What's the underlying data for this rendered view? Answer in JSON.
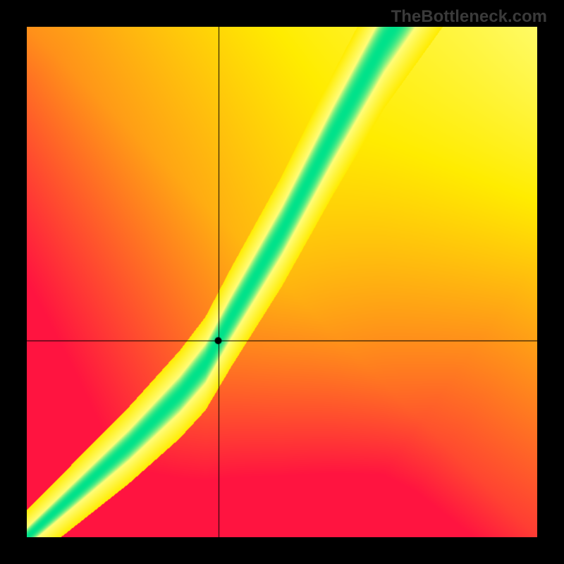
{
  "watermark": "TheBottleneck.com",
  "chart_data": {
    "type": "heatmap",
    "title": "",
    "xlabel": "",
    "ylabel": "",
    "xlim": [
      0,
      1
    ],
    "ylim": [
      0,
      1
    ],
    "crosshair": {
      "x": 0.375,
      "y": 0.385
    },
    "marker": {
      "x": 0.375,
      "y": 0.385
    },
    "ridge": {
      "description": "Green optimal band running diagonally; below ~0.35 it follows y≈x with slight curvature, above it steepens toward y≈1.85x-0.32",
      "points": [
        {
          "x": 0.0,
          "y": 0.0
        },
        {
          "x": 0.1,
          "y": 0.09
        },
        {
          "x": 0.2,
          "y": 0.18
        },
        {
          "x": 0.3,
          "y": 0.28
        },
        {
          "x": 0.35,
          "y": 0.34
        },
        {
          "x": 0.4,
          "y": 0.43
        },
        {
          "x": 0.5,
          "y": 0.6
        },
        {
          "x": 0.6,
          "y": 0.79
        },
        {
          "x": 0.7,
          "y": 0.97
        },
        {
          "x": 0.72,
          "y": 1.0
        }
      ]
    },
    "gradient_stops": {
      "far_below": "#ff1140",
      "near": "#ffec00",
      "on_ridge": "#00e28a",
      "far_above": "#ffe400",
      "corner_high": "#fffd55"
    }
  }
}
